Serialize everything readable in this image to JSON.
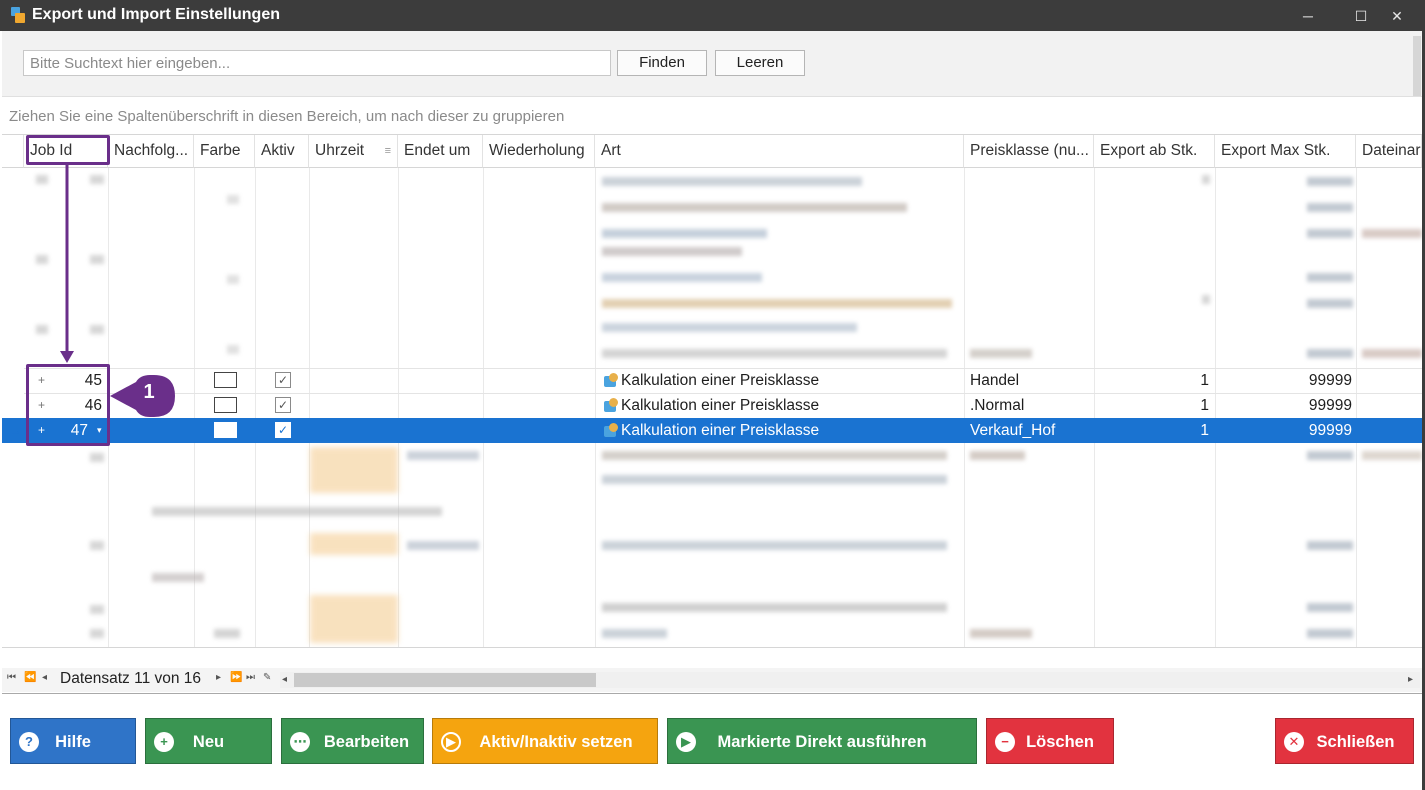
{
  "window": {
    "title": "Export und Import Einstellungen",
    "minimize": "─",
    "maximize": "☐",
    "close": "✕"
  },
  "search": {
    "placeholder": "Bitte Suchtext hier eingeben...",
    "value": "",
    "find_label": "Finden",
    "clear_label": "Leeren"
  },
  "group_hint": "Ziehen Sie eine Spaltenüberschrift in diesen Bereich, um nach dieser zu gruppieren",
  "grid": {
    "columns": [
      "Job Id",
      "Nachfolg...",
      "Farbe",
      "Aktiv",
      "Uhrzeit",
      "Endet um",
      "Wiederholung",
      "Art",
      "Preisklasse (nu...",
      "Export ab Stk.",
      "Export Max Stk.",
      "Dateinar"
    ],
    "rows": [
      {
        "expand": "+",
        "job_id": "45",
        "aktiv": "✓",
        "art": "Kalkulation einer Preisklasse",
        "preisklasse": "Handel",
        "export_ab": "1",
        "export_max": "99999"
      },
      {
        "expand": "+",
        "job_id": "46",
        "aktiv": "✓",
        "art": "Kalkulation einer Preisklasse",
        "preisklasse": ".Normal",
        "export_ab": "1",
        "export_max": "99999"
      },
      {
        "expand": "+",
        "job_id": "47",
        "aktiv": "✓",
        "art": "Kalkulation einer Preisklasse",
        "preisklasse": "Verkauf_Hof",
        "export_ab": "1",
        "export_max": "99999"
      }
    ],
    "selected_row": 2,
    "selected_indicator": "→"
  },
  "annotation": {
    "number": "1"
  },
  "navigator": {
    "text": "Datensatz 11 von 16"
  },
  "buttons": {
    "help": "Hilfe",
    "new": "Neu",
    "edit": "Bearbeiten",
    "toggle": "Aktiv/Inaktiv setzen",
    "run": "Markierte Direkt ausführen",
    "delete": "Löschen",
    "close": "Schließen"
  },
  "icons": {
    "help": "question-icon",
    "new": "plus-icon",
    "edit": "more-icon",
    "toggle": "pause-play-icon",
    "run": "play-icon",
    "delete": "minus-icon",
    "close": "x-icon"
  },
  "colors": {
    "titlebar": "#3c3c3c",
    "selection": "#1a73d1",
    "help": "#2f74c8",
    "new": "#3a9552",
    "edit": "#3a9552",
    "toggle": "#f5a40f",
    "run": "#3a9552",
    "delete": "#e2333f",
    "close": "#e2333f",
    "annotation": "#6a2f8a"
  }
}
